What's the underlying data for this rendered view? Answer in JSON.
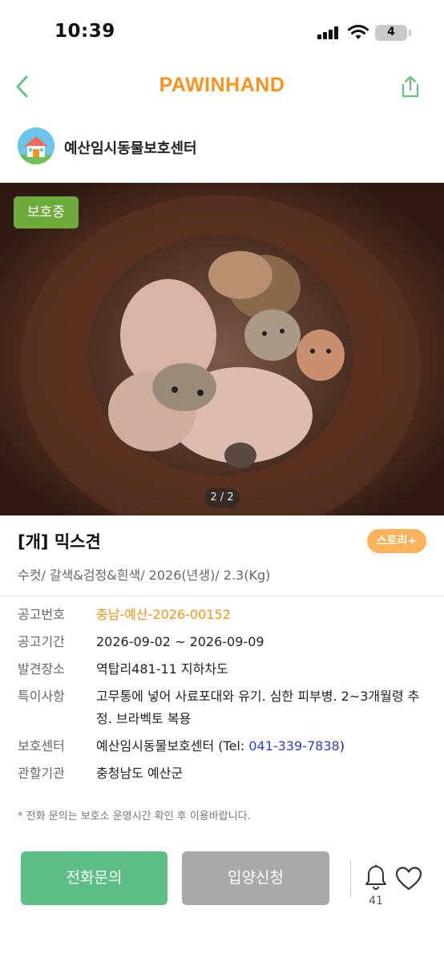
{
  "status_bar": {
    "time": "10:39",
    "battery": "4"
  },
  "header": {
    "brand": "PAWINHAND"
  },
  "shelter": {
    "name": "예산임시동물보호센터"
  },
  "photo": {
    "status_badge": "보호중",
    "page_indicator": "2 / 2"
  },
  "animal": {
    "title": "[개] 믹스견",
    "story_button": "스토리+",
    "subtitle": "수컷/ 갈색&검정&흰색/ 2026(년생)/ 2.3(Kg)"
  },
  "details": [
    {
      "label": "공고번호",
      "value": "충남-예산-2026-00152"
    },
    {
      "label": "공고기간",
      "value": "2026-09-02 ~ 2026-09-09"
    },
    {
      "label": "발견장소",
      "value": "역탑리481-11 지하차도"
    },
    {
      "label": "특이사항",
      "value": "고무통에 넣어 사료포대와 유기. 심한 피부병. 2~3개월령 추정. 브라벡토 복용"
    },
    {
      "label": "보호센터",
      "value_prefix": "예산임시동물보호센터 (Tel: ",
      "tel": "041-339-7838",
      "value_suffix": ")"
    },
    {
      "label": "관할기관",
      "value": "충청남도 예산군"
    }
  ],
  "notice": "* 전화 문의는 보호소 운영시간 확인 후 이용바랍니다.",
  "actions": {
    "call": "전화문의",
    "adopt": "입양신청",
    "bell_count": "41"
  },
  "colors": {
    "brand": "#f7931e",
    "badge": "#6fab3c",
    "call": "#5dbf85",
    "adopt": "#a9a9a9",
    "story": "#fbb25a",
    "tel": "#2a3ecf"
  },
  "icons": [
    "back-icon",
    "share-icon",
    "shelter-house-icon",
    "bell-icon",
    "heart-icon"
  ]
}
